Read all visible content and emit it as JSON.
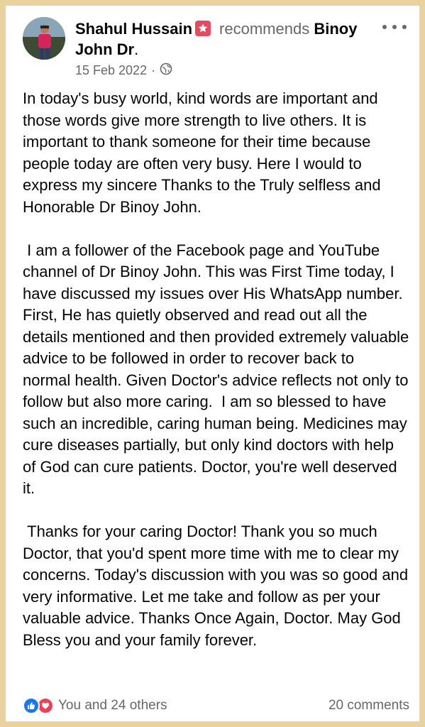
{
  "post": {
    "author": "Shahul Hussain",
    "verb": "recommends",
    "target": "Binoy John Dr",
    "target_suffix": ".",
    "date": "15 Feb 2022",
    "separator": "·",
    "privacy_icon": "globe-icon",
    "more_icon": "more-options-icon",
    "badge_icon": "recommend-star-icon",
    "badge_color": "#e8495c",
    "paragraphs": [
      "In today's busy world, kind words are important and those words give more strength to live others. It is important to thank someone for their time because people today are often very busy. Here I would to express my sincere Thanks to the Truly selfless and Honorable Dr Binoy John.",
      " I am a follower of the Facebook page and YouTube channel of Dr Binoy John. This was First Time today, I have discussed my issues over His WhatsApp number. First, He has quietly observed and read out all the details mentioned and then provided extremely valuable advice to be followed in order to recover back to  normal health. Given Doctor's advice reflects not only to follow but also more caring.  I am so blessed to have such an incredible, caring human being. Medicines may cure diseases partially, but only kind doctors with help of God can cure patients. Doctor, you're well deserved it.",
      " Thanks for your caring Doctor! Thank you so much Doctor, that you'd spent more time with me to clear my concerns. Today's discussion with you was so good and very informative. Let me take and follow as per your valuable advice. Thanks Once Again, Doctor. May God Bless you and your family forever."
    ]
  },
  "footer": {
    "reactions_text": "You and 24 others",
    "comments_text": "20 comments",
    "like_color": "#1877f2",
    "love_color": "#f33e58"
  },
  "colors": {
    "frame": "#ead2a0",
    "text": "#050505",
    "secondary": "#65676b"
  }
}
